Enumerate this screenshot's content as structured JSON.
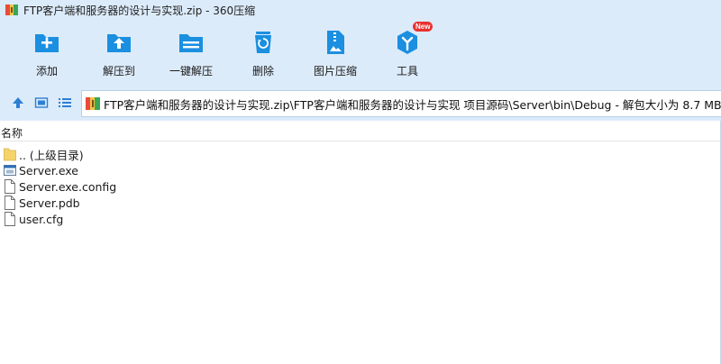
{
  "window": {
    "title": "FTP客户端和服务器的设计与实现.zip - 360压缩",
    "logo_icon": "360zip-logo-icon"
  },
  "toolbar": {
    "items": [
      {
        "label": "添加",
        "icon": "add-icon",
        "color": "#1b8fe0"
      },
      {
        "label": "解压到",
        "icon": "extract-to-icon",
        "color": "#1b8fe0"
      },
      {
        "label": "一键解压",
        "icon": "one-click-extract-icon",
        "color": "#1b8fe0"
      },
      {
        "label": "删除",
        "icon": "recycle-bin-icon",
        "color": "#1b8fe0"
      },
      {
        "label": "图片压缩",
        "icon": "image-compress-icon",
        "color": "#1b8fe0"
      },
      {
        "label": "工具",
        "icon": "tools-icon",
        "color": "#1b8fe0",
        "badge": "New"
      }
    ]
  },
  "navigation": {
    "up_icon": "arrow-up-icon",
    "view_thumbnail_icon": "thumbnail-view-icon",
    "view_list_icon": "list-view-icon"
  },
  "address": {
    "path": "FTP客户端和服务器的设计与实现.zip\\FTP客户端和服务器的设计与实现 项目源码\\Server\\bin\\Debug - 解包大小为 8.7 MB"
  },
  "list": {
    "header_name": "名称",
    "items": [
      {
        "name": ".. (上级目录)",
        "type": "folder"
      },
      {
        "name": "Server.exe",
        "type": "exe"
      },
      {
        "name": "Server.exe.config",
        "type": "file"
      },
      {
        "name": "Server.pdb",
        "type": "file"
      },
      {
        "name": "user.cfg",
        "type": "file"
      }
    ]
  },
  "colors": {
    "chrome_bg": "#dcebfa",
    "accent": "#1b8fe0",
    "badge": "#e8312f"
  }
}
